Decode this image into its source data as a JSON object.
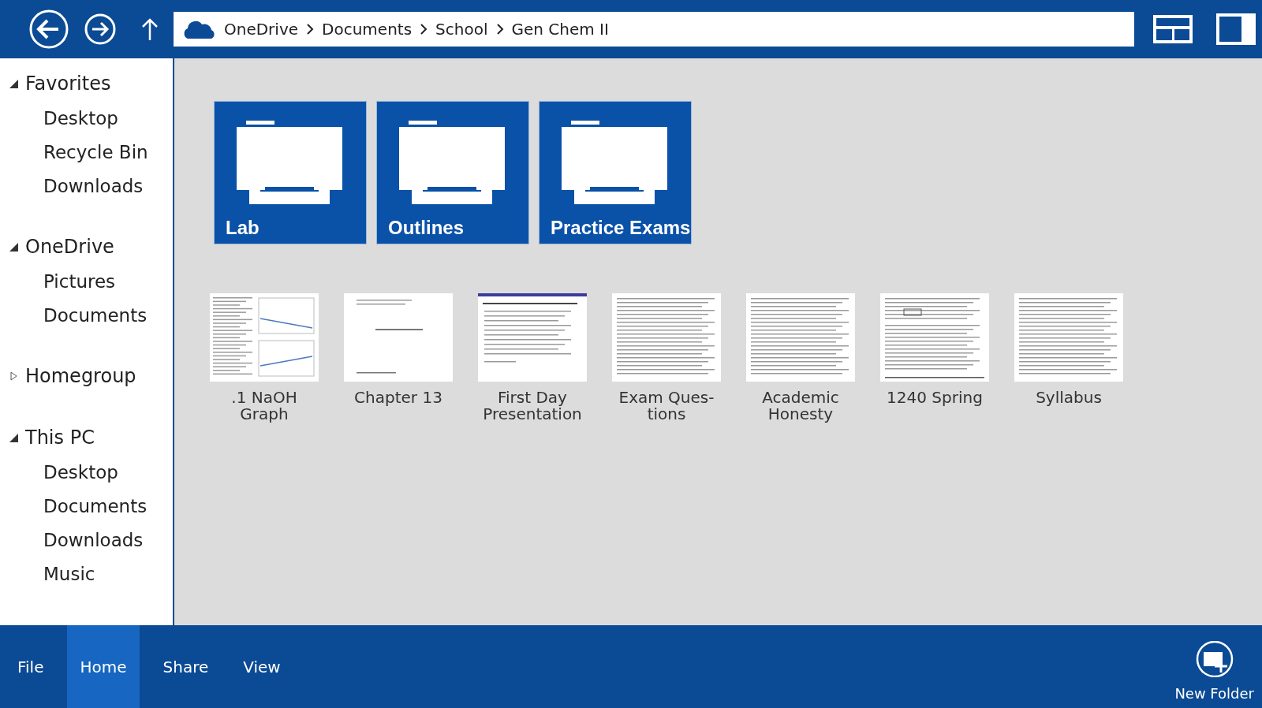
{
  "breadcrumb": [
    "OneDrive",
    "Documents",
    "School",
    "Gen Chem II"
  ],
  "sidebar": [
    {
      "label": "Favorites",
      "expanded": true,
      "items": [
        "Desktop",
        "Recycle Bin",
        "Downloads"
      ]
    },
    {
      "label": "OneDrive",
      "expanded": true,
      "items": [
        "Pictures",
        "Documents"
      ]
    },
    {
      "label": "Homegroup",
      "expanded": false
    },
    {
      "label": "This PC",
      "expanded": true,
      "items": [
        "Desktop",
        "Documents",
        "Downloads",
        "Music"
      ]
    }
  ],
  "folders": [
    {
      "name": "Lab"
    },
    {
      "name": "Outlines"
    },
    {
      "name": "Practice Exams"
    }
  ],
  "files": [
    {
      "name": ".1 NaOH Graph",
      "kind": "spreadsheet"
    },
    {
      "name": "Chapter 13",
      "kind": "slide"
    },
    {
      "name": "First Day Presentation",
      "kind": "bullets"
    },
    {
      "name": "Exam Ques-tions",
      "kind": "document"
    },
    {
      "name": "Academic Honesty",
      "kind": "document"
    },
    {
      "name": "1240 Spring",
      "kind": "form"
    },
    {
      "name": "Syllabus",
      "kind": "document"
    }
  ],
  "ribbon_tabs": [
    {
      "label": "File",
      "selected": false
    },
    {
      "label": "Home",
      "selected": true
    },
    {
      "label": "Share",
      "selected": false
    },
    {
      "label": "View",
      "selected": false
    }
  ],
  "actions": [
    {
      "label": "New Folder"
    }
  ]
}
